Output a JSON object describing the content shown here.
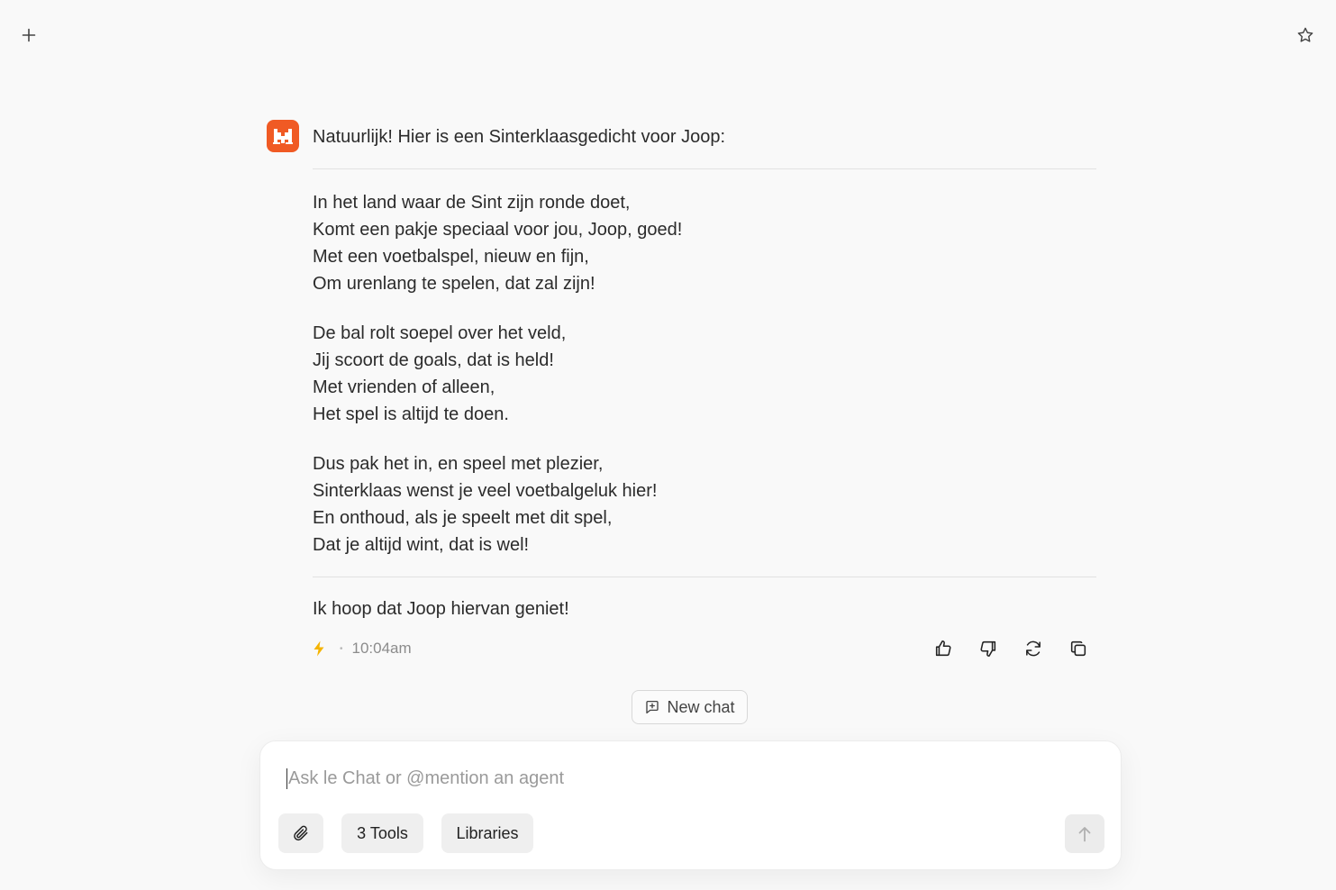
{
  "header": {
    "new_icon": "plus-icon",
    "favorite_icon": "star-icon"
  },
  "message": {
    "avatar_icon": "mistral-logo",
    "accent_color": "#f05a24",
    "intro": "Natuurlijk! Hier is een Sinterklaasgedicht voor Joop:",
    "stanzas": [
      [
        "In het land waar de Sint zijn ronde doet,",
        "Komt een pakje speciaal voor jou, Joop, goed!",
        "Met een voetbalspel, nieuw en fijn,",
        "Om urenlang te spelen, dat zal zijn!"
      ],
      [
        "De bal rolt soepel over het veld,",
        "Jij scoort de goals, dat is held!",
        "Met vrienden of alleen,",
        "Het spel is altijd te doen."
      ],
      [
        "Dus pak het in, en speel met plezier,",
        "Sinterklaas wenst je veel voetbalgeluk hier!",
        "En onthoud, als je speelt met dit spel,",
        "Dat je altijd wint, dat is wel!"
      ]
    ],
    "outro": "Ik hoop dat Joop hiervan geniet!",
    "meta": {
      "speed_icon": "lightning-icon",
      "separator": "•",
      "time": "10:04am"
    },
    "actions": [
      "thumbs-up-icon",
      "thumbs-down-icon",
      "regenerate-icon",
      "copy-icon"
    ]
  },
  "new_chat": {
    "label": "New chat",
    "icon": "chat-plus-icon"
  },
  "composer": {
    "placeholder": "Ask le Chat or @mention an agent",
    "value": "",
    "attach_icon": "paperclip-icon",
    "tools_label": "3 Tools",
    "libraries_label": "Libraries",
    "send_icon": "arrow-up-icon"
  }
}
